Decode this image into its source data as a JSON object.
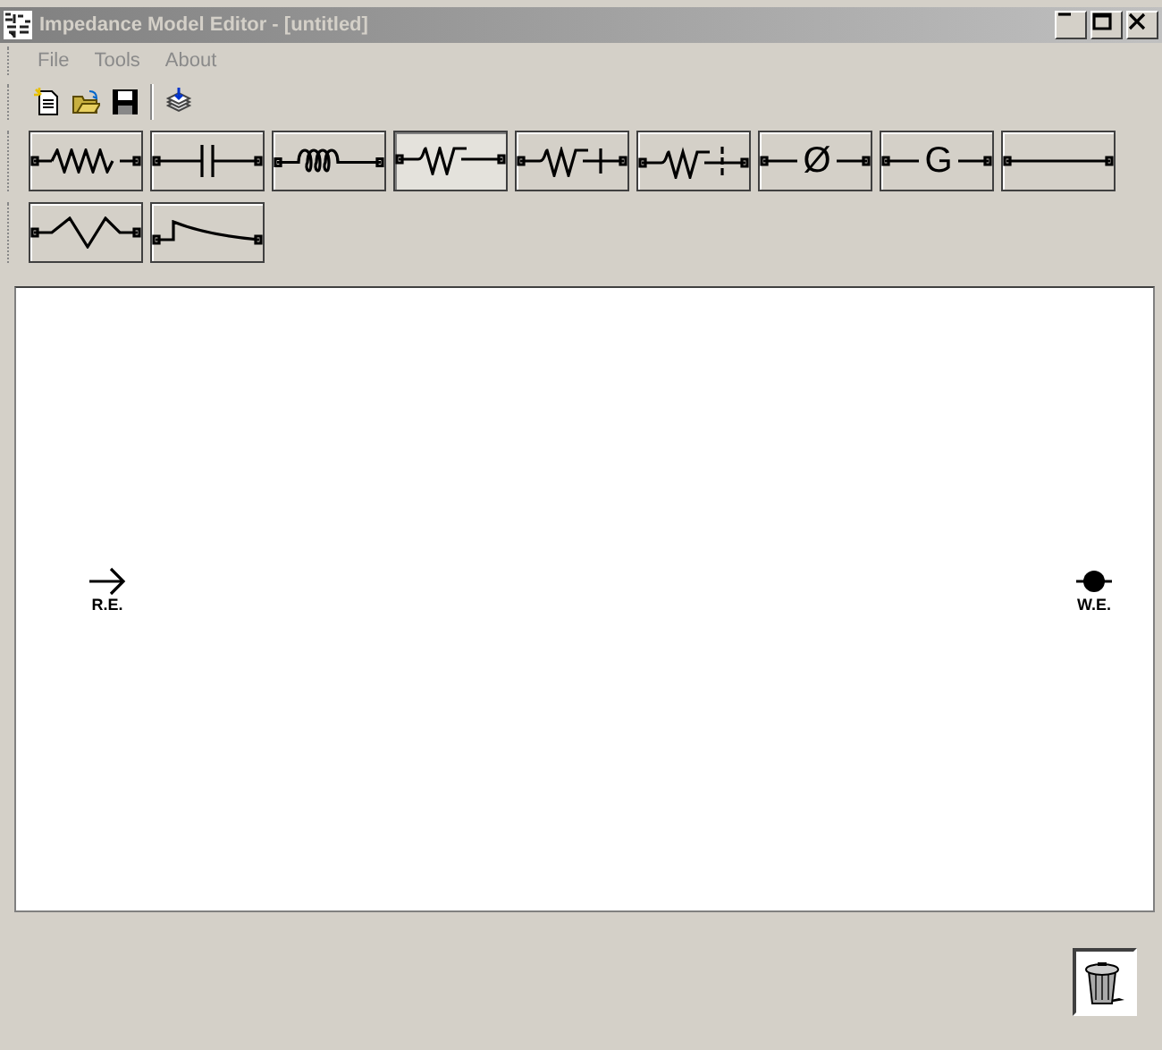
{
  "window": {
    "title": "Impedance Model Editor - [untitled]",
    "active": false
  },
  "menu": [
    {
      "label": "File",
      "disabled": true
    },
    {
      "label": "Tools",
      "disabled": true
    },
    {
      "label": "About",
      "disabled": true
    }
  ],
  "toolbar": [
    {
      "kind": "new"
    },
    {
      "kind": "open"
    },
    {
      "kind": "save"
    },
    {
      "kind": "separator"
    },
    {
      "kind": "export"
    }
  ],
  "component_rows": [
    [
      {
        "kind": "resistor",
        "selected": false
      },
      {
        "kind": "capacitor",
        "selected": false
      },
      {
        "kind": "inductor",
        "selected": false
      },
      {
        "kind": "warburg",
        "selected": true
      },
      {
        "kind": "warburg_short",
        "selected": false
      },
      {
        "kind": "warburg_open",
        "selected": false
      },
      {
        "kind": "symbol",
        "symbol": "Ø",
        "selected": false
      },
      {
        "kind": "symbol",
        "symbol": "G",
        "selected": false
      },
      {
        "kind": "wire",
        "selected": false
      }
    ],
    [
      {
        "kind": "zigzag",
        "selected": false
      },
      {
        "kind": "decay",
        "selected": false
      }
    ]
  ],
  "canvas": {
    "terminals": [
      {
        "kind": "reference",
        "label": "R.E."
      },
      {
        "kind": "working",
        "label": "W.E."
      }
    ]
  }
}
